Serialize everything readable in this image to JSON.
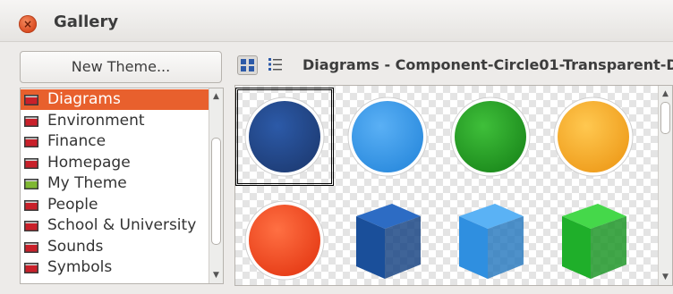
{
  "window": {
    "title": "Gallery",
    "close_glyph": "×"
  },
  "themes": {
    "new_theme_label": "New Theme...",
    "items": [
      {
        "label": "Diagrams",
        "selected": true,
        "icon": "theme-folder-icon"
      },
      {
        "label": "Environment",
        "selected": false,
        "icon": "theme-folder-icon"
      },
      {
        "label": "Finance",
        "selected": false,
        "icon": "theme-folder-icon"
      },
      {
        "label": "Homepage",
        "selected": false,
        "icon": "theme-folder-icon"
      },
      {
        "label": "My Theme",
        "selected": false,
        "icon": "user-theme-folder-icon"
      },
      {
        "label": "People",
        "selected": false,
        "icon": "theme-folder-icon"
      },
      {
        "label": "School & University",
        "selected": false,
        "icon": "theme-folder-icon"
      },
      {
        "label": "Sounds",
        "selected": false,
        "icon": "theme-folder-icon"
      },
      {
        "label": "Symbols",
        "selected": false,
        "icon": "theme-folder-icon"
      }
    ]
  },
  "gallery": {
    "heading": "Diagrams - Component-Circle01-Transparent-D",
    "view_buttons": [
      {
        "name": "icon-view",
        "active": true
      },
      {
        "name": "detail-view",
        "active": false
      }
    ],
    "items": [
      {
        "shape": "circle",
        "color": "#1f3f7a",
        "highlight": "#2c5aa8",
        "selected": true
      },
      {
        "shape": "circle",
        "color": "#2f8ee0",
        "highlight": "#5ab0f5",
        "selected": false
      },
      {
        "shape": "circle",
        "color": "#1f8f1f",
        "highlight": "#3fbf3a",
        "selected": false
      },
      {
        "shape": "circle",
        "color": "#f0a020",
        "highlight": "#ffc850",
        "selected": false
      },
      {
        "shape": "circle",
        "color": "#e8401a",
        "highlight": "#ff7043",
        "selected": false
      },
      {
        "shape": "cube",
        "color": "#1a4f9a",
        "highlight": "#2d6cc4",
        "selected": false
      },
      {
        "shape": "cube",
        "color": "#2f8fe0",
        "highlight": "#5ab2f5",
        "selected": false
      },
      {
        "shape": "cube",
        "color": "#1faf2a",
        "highlight": "#45d84a",
        "selected": false
      }
    ]
  },
  "colors": {
    "accent": "#e8602d",
    "close_button": "#df4b22"
  }
}
